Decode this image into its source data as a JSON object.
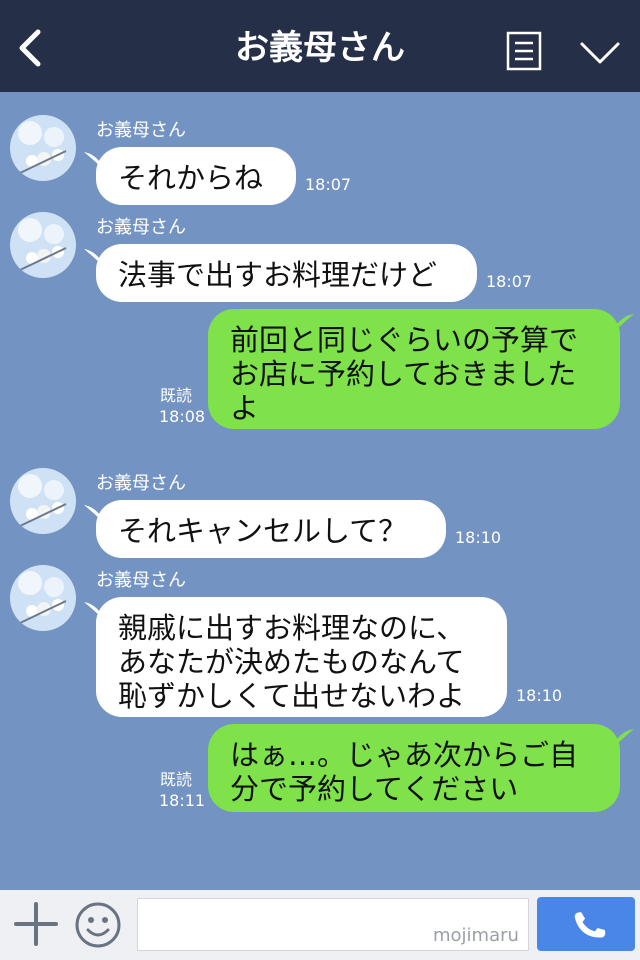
{
  "header": {
    "title": "お義母さん"
  },
  "colors": {
    "header_bg": "#262f48",
    "chat_bg": "#7393c2",
    "outgoing_bubble": "#7fe24a",
    "incoming_bubble": "#ffffff",
    "call_button": "#4a86e8"
  },
  "messages": [
    {
      "sender": "お義母さん",
      "text": "それからね",
      "time": "18:07"
    },
    {
      "sender": "お義母さん",
      "text": "法事で出すお料理だけど",
      "time": "18:07"
    },
    {
      "text": "前回と同じぐらいの予算で\nお店に予約しておきました\nよ",
      "read": "既読",
      "time": "18:08"
    },
    {
      "sender": "お義母さん",
      "text": "それキャンセルして？",
      "time": "18:10"
    },
    {
      "sender": "お義母さん",
      "text": "親戚に出すお料理なのに、\nあなたが決めたものなんて\n恥ずかしくて出せないわよ",
      "time": "18:10"
    },
    {
      "text": "はぁ…。じゃあ次からご自\n分で予約してください",
      "read": "既読",
      "time": "18:11"
    }
  ],
  "footer": {
    "watermark": "mojimaru"
  },
  "icons": [
    "back-icon",
    "menu-icon",
    "chevron-down-icon",
    "plus-icon",
    "emoji-icon",
    "phone-icon"
  ]
}
